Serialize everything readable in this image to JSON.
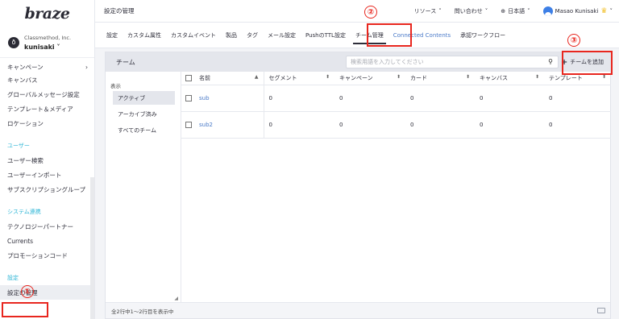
{
  "logo": "braze",
  "account": {
    "org": "Classmethod, Inc.",
    "name": "kunisaki",
    "icon_letter": "ð"
  },
  "sidebar": {
    "items_top": [
      {
        "label": "キャンペーン"
      },
      {
        "label": "キャンバス"
      },
      {
        "label": "グローバルメッセージ設定"
      },
      {
        "label": "テンプレート＆メディア"
      },
      {
        "label": "ロケーション"
      }
    ],
    "section_users": "ユーザー",
    "items_users": [
      {
        "label": "ユーザー検索"
      },
      {
        "label": "ユーザーインポート"
      },
      {
        "label": "サブスクリプショングループ"
      }
    ],
    "section_integrations": "システム連携",
    "items_integrations": [
      {
        "label": "テクノロジーパートナー"
      },
      {
        "label": "Currents"
      },
      {
        "label": "プロモーションコード"
      }
    ],
    "section_settings": "設定",
    "active_item": "設定の管理"
  },
  "topbar": {
    "title": "設定の管理",
    "resources": "リソース",
    "contact": "問い合わせ",
    "language": "日本語",
    "user": "Masao Kunisaki"
  },
  "tabs": [
    {
      "label": "設定"
    },
    {
      "label": "カスタム属性"
    },
    {
      "label": "カスタムイベント"
    },
    {
      "label": "製品"
    },
    {
      "label": "タグ"
    },
    {
      "label": "メール設定"
    },
    {
      "label": "PushのTTL設定"
    },
    {
      "label": "チーム管理",
      "active": true
    },
    {
      "label": "Connected Contents"
    },
    {
      "label": "承認ワークフロー"
    }
  ],
  "panel": {
    "title": "チーム",
    "search_placeholder": "検索用語を入力してください",
    "add_button": "チームを追加",
    "filter_label": "表示",
    "filter_options": [
      "アクティブ",
      "アーカイブ済み",
      "すべてのチーム"
    ],
    "columns": [
      "名前",
      "セグメント",
      "キャンペーン",
      "カード",
      "キャンバス",
      "テンプレート"
    ],
    "rows": [
      {
        "name": "sub",
        "segments": "0",
        "campaigns": "0",
        "cards": "0",
        "canvases": "0",
        "templates": "0"
      },
      {
        "name": "sub2",
        "segments": "0",
        "campaigns": "0",
        "cards": "0",
        "canvases": "0",
        "templates": "0"
      }
    ],
    "footer": "全2行中1〜2行目を表示中"
  },
  "annotations": [
    "①",
    "②",
    "③"
  ],
  "colors": {
    "annotation": "#e8261e",
    "link": "#4a7ac8",
    "section": "#2fb6d6"
  }
}
